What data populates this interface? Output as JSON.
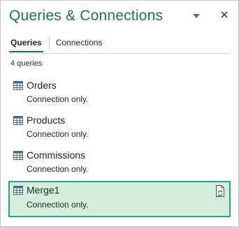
{
  "pane": {
    "title": "Queries & Connections",
    "dropdown_icon": "chevron-down-icon",
    "close_icon": "close-icon"
  },
  "tabs": [
    {
      "label": "Queries",
      "active": true
    },
    {
      "label": "Connections",
      "active": false
    }
  ],
  "query_count": "4 queries",
  "queries": [
    {
      "name": "Orders",
      "status": "Connection only.",
      "icon": "table-icon",
      "selected": false
    },
    {
      "name": "Products",
      "status": "Connection only.",
      "icon": "table-icon",
      "selected": false
    },
    {
      "name": "Commissions",
      "status": "Connection only.",
      "icon": "table-icon",
      "selected": false
    },
    {
      "name": "Merge1",
      "status": "Connection only.",
      "icon": "table-icon",
      "selected": true,
      "action_icon": "refresh-icon"
    }
  ],
  "colors": {
    "accent": "#217346",
    "selected_bg": "#d4f0dd",
    "selected_border": "#2fa084"
  }
}
